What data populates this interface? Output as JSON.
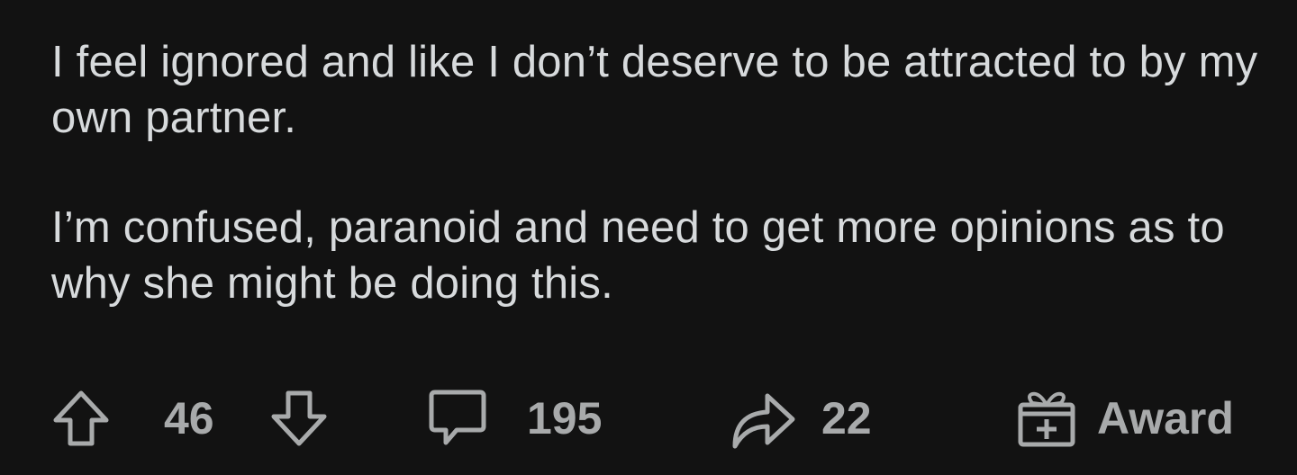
{
  "post": {
    "paragraphs": [
      "I feel ignored and like I don’t deserve to be attracted to by my own partner.",
      "I’m confused, paranoid and need to get more opinions as to why she might be doing this."
    ]
  },
  "actions": {
    "upvote_icon": "arrow-up-icon",
    "vote_count": "46",
    "downvote_icon": "arrow-down-icon",
    "comment_icon": "speech-bubble-icon",
    "comment_count": "195",
    "share_icon": "share-arrow-icon",
    "share_count": "22",
    "award_icon": "gift-icon",
    "award_label": "Award"
  },
  "colors": {
    "background": "#121212",
    "body_text": "#d7dadc",
    "action_text": "#a8aaab"
  }
}
